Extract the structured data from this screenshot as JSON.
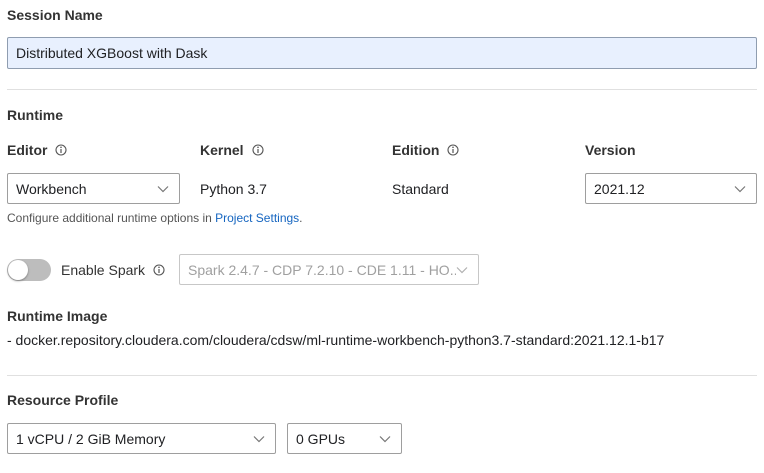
{
  "session_name": {
    "label": "Session Name",
    "value": "Distributed XGBoost with Dask"
  },
  "runtime": {
    "section_title": "Runtime",
    "editor": {
      "label": "Editor",
      "value": "Workbench",
      "icon": "info-icon"
    },
    "kernel": {
      "label": "Kernel",
      "value": "Python 3.7",
      "icon": "info-icon"
    },
    "edition": {
      "label": "Edition",
      "value": "Standard",
      "icon": "info-icon"
    },
    "version": {
      "label": "Version",
      "value": "2021.12"
    },
    "help_prefix": "Configure additional runtime options in ",
    "help_link": "Project Settings",
    "help_suffix": "."
  },
  "spark": {
    "toggle_label": "Enable Spark",
    "enabled": false,
    "select_value": "Spark 2.4.7 - CDP 7.2.10 - CDE 1.11 - HO..."
  },
  "runtime_image": {
    "title": "Runtime Image",
    "value": "- docker.repository.cloudera.com/cloudera/cdsw/ml-runtime-workbench-python3.7-standard:2021.12.1-b17"
  },
  "resource_profile": {
    "title": "Resource Profile",
    "cpu_memory": "1 vCPU / 2 GiB Memory",
    "gpus": "0 GPUs"
  },
  "colors": {
    "link": "#1565c0",
    "input_fill": "#e8f0fe",
    "toggle_off": "#bdbdbd"
  }
}
